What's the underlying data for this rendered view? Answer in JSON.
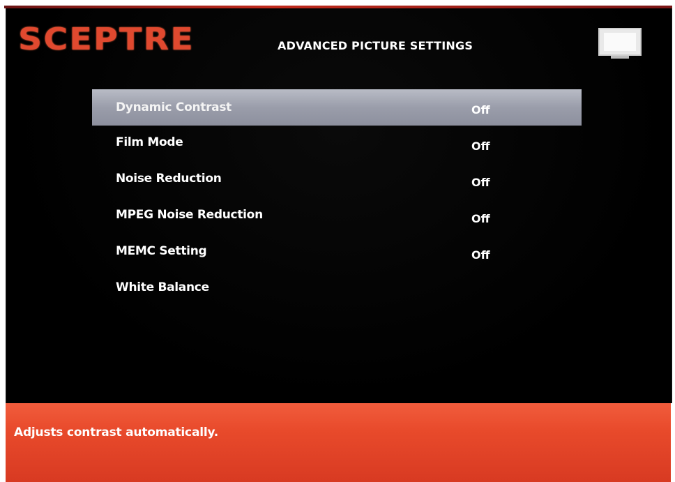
{
  "brand": {
    "logo_text": "SCEPTRE",
    "logo_color": "#e0492f"
  },
  "header": {
    "title": "ADVANCED PICTURE SETTINGS",
    "tv_icon": "tv-icon"
  },
  "menu": {
    "items": [
      {
        "label": "Dynamic Contrast",
        "value": "Off",
        "selected": true
      },
      {
        "label": "Film Mode",
        "value": "Off",
        "selected": false
      },
      {
        "label": "Noise Reduction",
        "value": "Off",
        "selected": false
      },
      {
        "label": "MPEG Noise Reduction",
        "value": "Off",
        "selected": false
      },
      {
        "label": "MEMC Setting",
        "value": "Off",
        "selected": false
      },
      {
        "label": "White Balance",
        "value": "",
        "selected": false
      }
    ]
  },
  "footer": {
    "help_text": "Adjusts contrast automatically."
  },
  "colors": {
    "background": "#000000",
    "highlight": "#a4a7b3",
    "footer": "#e84a2b",
    "text": "#ffffff"
  }
}
